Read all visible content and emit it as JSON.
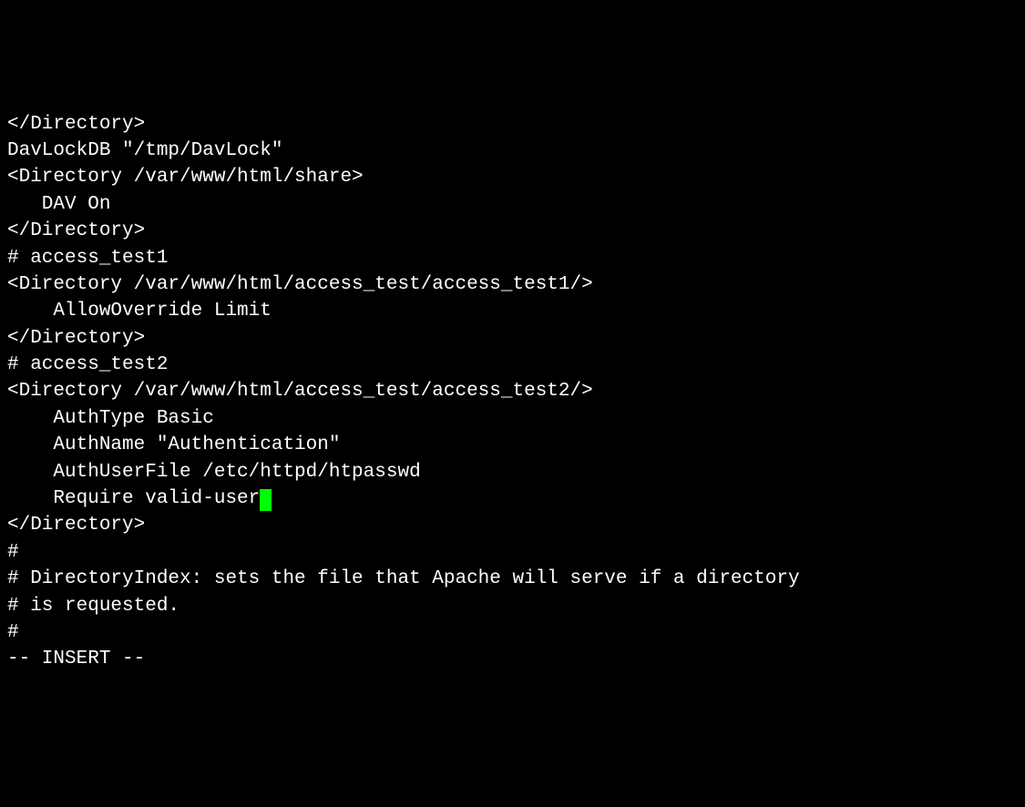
{
  "lines": {
    "l0": "</Directory>",
    "l1": "DavLockDB \"/tmp/DavLock\"",
    "l2": "<Directory /var/www/html/share>",
    "l3": "   DAV On",
    "l4": "</Directory>",
    "l5": "",
    "l6": "# access_test1",
    "l7": "<Directory /var/www/html/access_test/access_test1/>",
    "l8": "    AllowOverride Limit",
    "l9": "</Directory>",
    "l10": "",
    "l11": "# access_test2",
    "l12": "<Directory /var/www/html/access_test/access_test2/>",
    "l13": "    AuthType Basic",
    "l14": "    AuthName \"Authentication\"",
    "l15": "    AuthUserFile /etc/httpd/htpasswd",
    "l16": "    Require valid-user",
    "l17": "</Directory>",
    "l18": "",
    "l19": "#",
    "l20": "# DirectoryIndex: sets the file that Apache will serve if a directory",
    "l21": "# is requested.",
    "l22": "#"
  },
  "status_line": "-- INSERT --"
}
